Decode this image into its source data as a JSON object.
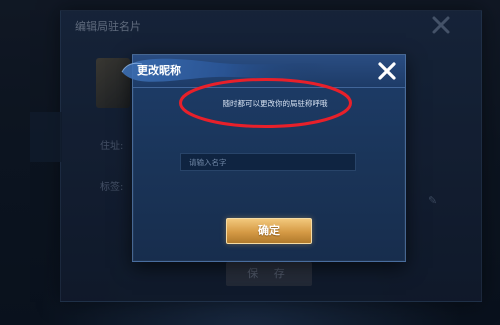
{
  "background_panel": {
    "title": "编辑局驻名片",
    "location_label": "住址:",
    "profile_label": "标签:",
    "save_label": "保 存"
  },
  "modal": {
    "title": "更改昵称",
    "hint": "随时都可以更改你的局驻称呼哦",
    "input": {
      "value": "",
      "placeholder": "请输入名字"
    },
    "confirm_label": "确定"
  },
  "colors": {
    "accent_gold": "#d59a45",
    "annotation_red": "#e8202a",
    "modal_blue": "#1d3d6a"
  },
  "icons": {
    "close": "close-icon",
    "edit": "pencil-icon"
  }
}
